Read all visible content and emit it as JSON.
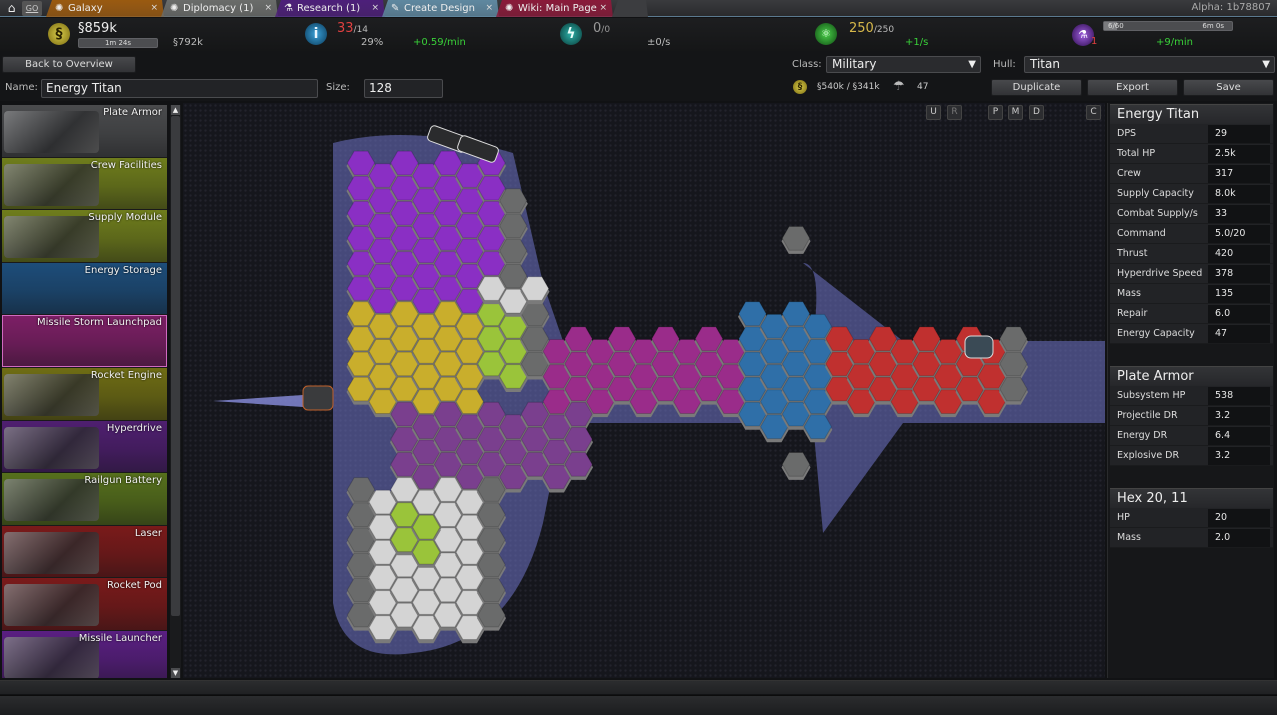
{
  "tabbar": {
    "home_icon": "home-icon",
    "go_label": "GO",
    "tabs": [
      {
        "label": "Galaxy",
        "icon": "galaxy-icon",
        "color": "#9a5a10",
        "active": false
      },
      {
        "label": "Diplomacy (1)",
        "icon": "galaxy-icon",
        "color": "#6a6c6a",
        "active": false
      },
      {
        "label": "Research (1)",
        "icon": "flask-icon",
        "color": "#4d1f7a",
        "active": false
      },
      {
        "label": "Create Design",
        "icon": "wrench-icon",
        "color": "#5f88a0",
        "active": true
      },
      {
        "label": "Wiki: Main Page",
        "icon": "galaxy-icon",
        "color": "#8a1a3a",
        "active": false
      }
    ],
    "close_glyph": "×",
    "version": "Alpha: 1b78807"
  },
  "resources": {
    "money": {
      "value": "§859k",
      "timer": "1m 24s",
      "income": "§792k",
      "icon": "§"
    },
    "influence": {
      "value": "33",
      "max": "/14",
      "percent": "29%",
      "rate": "+0.59/min"
    },
    "energy": {
      "value": "0",
      "max": "/0",
      "rate": "±0/s"
    },
    "defense": {
      "value": "250",
      "max": "/250",
      "rate": "+1/s"
    },
    "research": {
      "count": "1",
      "progress_label": "6/60",
      "progress": 0.1,
      "time": "6m 0s",
      "rate": "+9/min"
    }
  },
  "controls": {
    "back_label": "Back to Overview",
    "name_label": "Name:",
    "name_value": "Energy Titan",
    "size_label": "Size:",
    "size_value": "128",
    "class_label": "Class:",
    "class_value": "Military",
    "hull_label": "Hull:",
    "hull_value": "Titan",
    "cost": "§540k / §341k",
    "labor": "47",
    "duplicate_label": "Duplicate",
    "export_label": "Export",
    "save_label": "Save"
  },
  "palette": [
    {
      "label": "Plate Armor",
      "color": "#4a4b4d"
    },
    {
      "label": "Crew Facilities",
      "color": "#6f7d1c"
    },
    {
      "label": "Supply Module",
      "color": "#6f7d1c"
    },
    {
      "label": "Energy Storage",
      "color": "#1d4d7a"
    },
    {
      "label": "Missile Storm Launchpad",
      "color": "#7d1f66"
    },
    {
      "label": "Rocket Engine",
      "color": "#6f6d14"
    },
    {
      "label": "Hyperdrive",
      "color": "#4f1f70"
    },
    {
      "label": "Railgun Battery",
      "color": "#56701c"
    },
    {
      "label": "Laser",
      "color": "#7a1a1a"
    },
    {
      "label": "Rocket Pod",
      "color": "#7a1a1a"
    },
    {
      "label": "Missile Launcher",
      "color": "#5a1f82"
    }
  ],
  "view_buttons": {
    "u": "U",
    "r": "R",
    "p": "P",
    "m": "M",
    "d": "D",
    "c": "C"
  },
  "design_stats": {
    "title": "Energy Titan",
    "rows": [
      {
        "k": "DPS",
        "v": "29"
      },
      {
        "k": "Total HP",
        "v": "2.5k"
      },
      {
        "k": "Crew",
        "v": "317"
      },
      {
        "k": "Supply Capacity",
        "v": "8.0k"
      },
      {
        "k": "Combat Supply/s",
        "v": "33"
      },
      {
        "k": "Command",
        "v": "5.0/20"
      },
      {
        "k": "Thrust",
        "v": "420"
      },
      {
        "k": "Hyperdrive Speed",
        "v": "378"
      },
      {
        "k": "Mass",
        "v": "135"
      },
      {
        "k": "Repair",
        "v": "6.0"
      },
      {
        "k": "Energy Capacity",
        "v": "47"
      }
    ]
  },
  "subsystem_stats": {
    "title": "Plate Armor",
    "rows": [
      {
        "k": "Subsystem HP",
        "v": "538"
      },
      {
        "k": "Projectile DR",
        "v": "3.2"
      },
      {
        "k": "Energy DR",
        "v": "6.4"
      },
      {
        "k": "Explosive DR",
        "v": "3.2"
      }
    ]
  },
  "hex_stats": {
    "title": "Hex 20, 11",
    "rows": [
      {
        "k": "HP",
        "v": "20"
      },
      {
        "k": "Mass",
        "v": "2.0"
      }
    ]
  },
  "ship": {
    "colors": {
      "purple": "#8a2fc4",
      "yellow": "#c9ae2c",
      "gray": "#d4d4d4",
      "armor": "#6a6b6b",
      "green": "#9ac43a",
      "magenta": "#9a2c8a",
      "blue": "#2f6fa8",
      "red": "#c0302f",
      "darkpurple": "#7a3f8e",
      "hull": "#6f75c8"
    }
  }
}
